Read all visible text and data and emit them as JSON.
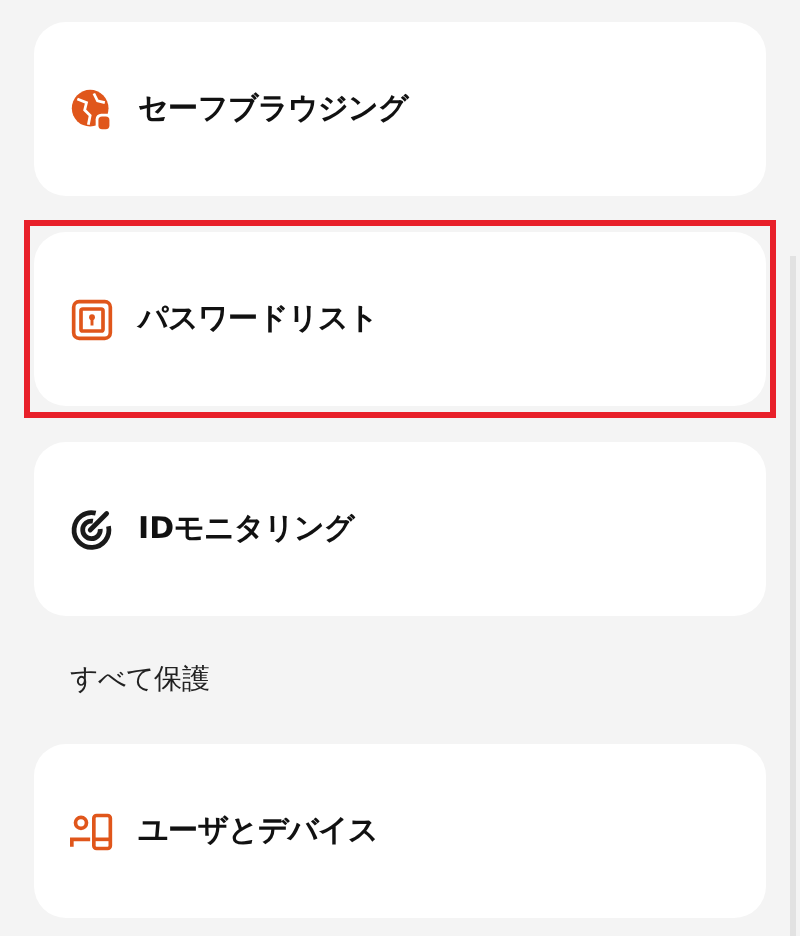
{
  "items": [
    {
      "kind": "globe-shield",
      "label": "セーフブラウジング",
      "color": "#e0561b",
      "highlighted": false
    },
    {
      "kind": "keyhole",
      "label": "パスワードリスト",
      "color": "#e0561b",
      "highlighted": true
    },
    {
      "kind": "target",
      "label": "IDモニタリング",
      "color": "#1a1a1a",
      "highlighted": false
    },
    {
      "kind": "section",
      "label": "すべて保護"
    },
    {
      "kind": "user-device",
      "label": "ユーザとデバイス",
      "color": "#e0561b",
      "highlighted": false
    }
  ]
}
